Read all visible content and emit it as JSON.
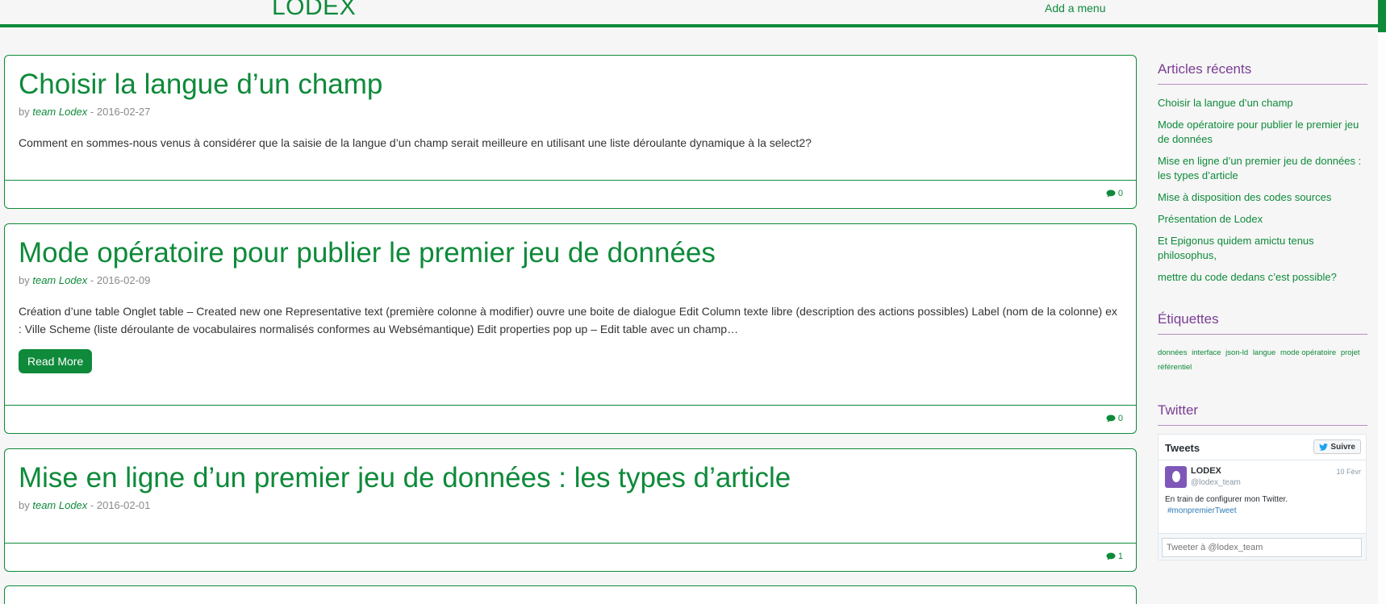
{
  "header": {
    "brand": "LODEX",
    "menu_link": "Add a menu"
  },
  "posts": [
    {
      "title": "Choisir la langue d’un champ",
      "by": "by",
      "author": "team Lodex",
      "date": "- 2016-02-27",
      "excerpt": "Comment en sommes-nous venus à considérer que la saisie de la langue d’un champ serait meilleure en utilisant une liste déroulante dynamique à la select2?",
      "comments": "0"
    },
    {
      "title": "Mode opératoire pour publier le premier jeu de données",
      "by": "by",
      "author": "team Lodex",
      "date": "- 2016-02-09",
      "excerpt": "Création d’une table Onglet table – Created new one Representative text (première colonne à modifier) ouvre une boite de dialogue Edit Column texte libre (description des actions possibles) Label (nom de la colonne) ex : Ville Scheme (liste déroulante de vocabulaires normalisés conformes au Websémantique) Edit properties pop up – Edit table avec un champ…",
      "read_more": "Read More",
      "comments": "0"
    },
    {
      "title": "Mise en ligne d’un premier jeu de données : les types d’article",
      "by": "by",
      "author": "team Lodex",
      "date": "- 2016-02-01",
      "comments": "1"
    }
  ],
  "sidebar": {
    "recent_title": "Articles récents",
    "recent_items": [
      "Choisir la langue d’un champ",
      "Mode opératoire pour publier le premier jeu de données",
      "Mise en ligne d’un premier jeu de données : les types d’article",
      "Mise à disposition des codes sources",
      "Présentation de Lodex",
      "Et Epigonus quidem amictu tenus philosophus,",
      "mettre du code dedans c’est possible?"
    ],
    "tags_title": "Étiquettes",
    "tags": [
      "données",
      "interface",
      "json-ld",
      "langue",
      "mode opératoire",
      "projet",
      "référentiel"
    ],
    "twitter_title": "Twitter",
    "twitter": {
      "header": "Tweets",
      "follow": "Suivre",
      "name": "LODEX",
      "handle": "@lodex_team",
      "date": "10 Févr",
      "text": "En train de configurer mon Twitter.",
      "hashtag": "#monpremierTweet",
      "compose_placeholder": "Tweeter à @lodex_team"
    }
  },
  "colors": {
    "accent": "#0e8a3a",
    "widget_title": "#7a3e93"
  }
}
